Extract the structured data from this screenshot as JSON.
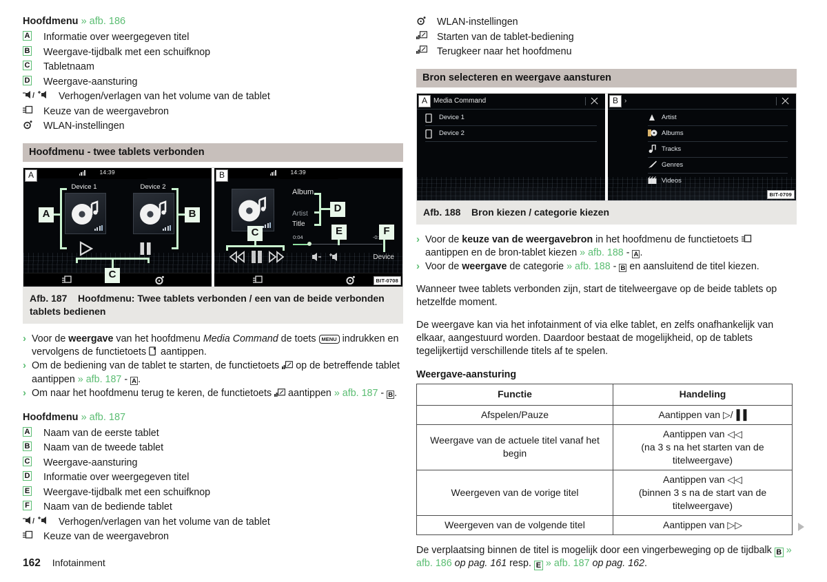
{
  "page": {
    "number": "162",
    "section": "Infotainment",
    "continuation_marker": "play-triangle"
  },
  "colors": {
    "accent_green": "#5bbd72",
    "section_header_bg": "#c7bfbb",
    "caption_bg": "#e8e7e4"
  },
  "left_column": {
    "legend1": {
      "title": "Hoofdmenu",
      "title_ref": "» afb. 186",
      "items": [
        {
          "key": "A",
          "key_type": "letter",
          "text": "Informatie over weergegeven titel"
        },
        {
          "key": "B",
          "key_type": "letter",
          "text": "Weergave-tijdbalk met een schuifknop"
        },
        {
          "key": "C",
          "key_type": "letter",
          "text": "Tabletnaam"
        },
        {
          "key": "D",
          "key_type": "letter",
          "text": "Weergave-aansturing"
        },
        {
          "key": "volume-up-down-icon",
          "key_type": "icon",
          "text": "Verhogen/verlagen van het volume van de tablet"
        },
        {
          "key": "source-select-icon",
          "key_type": "icon",
          "text": "Keuze van de weergavebron"
        },
        {
          "key": "wlan-settings-icon",
          "key_type": "icon",
          "text": "WLAN-instellingen"
        }
      ]
    },
    "section_header": "Hoofdmenu - twee tablets verbonden",
    "figure": {
      "caption_number": "Afb. 187",
      "caption_text": "Hoofdmenu: Twee tablets verbonden / een van de beide verbonden tablets bedienen",
      "code": "BIT-0708",
      "screen_a": {
        "badge": "A",
        "clock": "14:39",
        "device1": "Device 1",
        "device2": "Device 2",
        "markers": [
          "A",
          "B",
          "C"
        ]
      },
      "screen_b": {
        "badge": "B",
        "clock": "14:39",
        "album": "Album",
        "artist": "Artist",
        "title": "Title",
        "time_elapsed": "0:04",
        "time_remaining": "-0:19",
        "device": "Device",
        "markers": [
          "C",
          "D",
          "E",
          "F"
        ]
      }
    },
    "bullets": [
      {
        "parts": [
          {
            "t": "Voor de "
          },
          {
            "t": "weergave",
            "style": "bold"
          },
          {
            "t": " van het hoofdmenu "
          },
          {
            "t": "Media Command",
            "style": "italic"
          },
          {
            "t": " de toets "
          },
          {
            "t": "MENU",
            "style": "key"
          },
          {
            "t": " indrukken en vervolgens de functietoets "
          },
          {
            "t": "media-command-icon",
            "style": "icon"
          },
          {
            "t": " aantippen."
          }
        ]
      },
      {
        "parts": [
          {
            "t": "Om de bediening van de tablet te starten, de functietoets "
          },
          {
            "t": "tablet-control-icon",
            "style": "icon"
          },
          {
            "t": " op de betreffende tablet aantippen "
          },
          {
            "t": "» afb. 187",
            "style": "ref"
          },
          {
            "t": " - "
          },
          {
            "t": "A",
            "style": "ltr-sm"
          },
          {
            "t": "."
          }
        ]
      },
      {
        "parts": [
          {
            "t": "Om naar het hoofdmenu terug te keren, de functietoets "
          },
          {
            "t": "tablet-control-icon",
            "style": "icon"
          },
          {
            "t": " aantippen "
          },
          {
            "t": "» afb. 187",
            "style": "ref"
          },
          {
            "t": " - "
          },
          {
            "t": "B",
            "style": "ltr-sm"
          },
          {
            "t": "."
          }
        ]
      }
    ],
    "legend2": {
      "title": "Hoofdmenu",
      "title_ref": "» afb. 187",
      "items": [
        {
          "key": "A",
          "key_type": "letter",
          "text": "Naam van de eerste tablet"
        },
        {
          "key": "B",
          "key_type": "letter",
          "text": "Naam van de tweede tablet"
        },
        {
          "key": "C",
          "key_type": "letter",
          "text": "Weergave-aansturing"
        },
        {
          "key": "D",
          "key_type": "letter",
          "text": "Informatie over weergegeven titel"
        },
        {
          "key": "E",
          "key_type": "letter",
          "text": "Weergave-tijdbalk met een schuifknop"
        },
        {
          "key": "F",
          "key_type": "letter",
          "text": "Naam van de bediende tablet"
        },
        {
          "key": "volume-up-down-icon",
          "key_type": "icon",
          "text": "Verhogen/verlagen van het volume van de tablet"
        },
        {
          "key": "source-select-icon",
          "key_type": "icon",
          "text": "Keuze van de weergavebron"
        }
      ]
    }
  },
  "right_column": {
    "legend_continued": [
      {
        "key": "wlan-settings-icon",
        "key_type": "icon",
        "text": "WLAN-instellingen"
      },
      {
        "key": "tablet-control-icon",
        "key_type": "icon",
        "text": "Starten van de tablet-bediening"
      },
      {
        "key": "tablet-control-icon",
        "key_type": "icon",
        "text": "Terugkeer naar het hoofdmenu"
      }
    ],
    "section_header": "Bron selecteren en weergave aansturen",
    "figure": {
      "caption_number": "Afb. 188",
      "caption_text": "Bron kiezen / categorie kiezen",
      "code": "BIT-0709",
      "screen_a": {
        "badge": "A",
        "title": "Media Command",
        "rows": [
          "Device 1",
          "Device 2"
        ]
      },
      "screen_b": {
        "badge": "B",
        "title": "",
        "breadcrumb": "›",
        "rows": [
          "Artist",
          "Albums",
          "Tracks",
          "Genres",
          "Videos"
        ]
      }
    },
    "bullets": [
      {
        "parts": [
          {
            "t": "Voor de "
          },
          {
            "t": "keuze van de weergavebron",
            "style": "bold"
          },
          {
            "t": " in het hoofdmenu de functietoets "
          },
          {
            "t": "source-select-icon",
            "style": "icon"
          },
          {
            "t": " aantippen en de bron-tablet kiezen "
          },
          {
            "t": "» afb. 188",
            "style": "ref"
          },
          {
            "t": " - "
          },
          {
            "t": "A",
            "style": "ltr-sm"
          },
          {
            "t": "."
          }
        ]
      },
      {
        "parts": [
          {
            "t": "Voor de "
          },
          {
            "t": "weergave",
            "style": "bold"
          },
          {
            "t": " de categorie "
          },
          {
            "t": "» afb. 188",
            "style": "ref"
          },
          {
            "t": " - "
          },
          {
            "t": "B",
            "style": "ltr-sm"
          },
          {
            "t": " en aansluitend de titel kiezen."
          }
        ]
      }
    ],
    "paragraphs": [
      "Wanneer twee tablets verbonden zijn, start de titelweergave op de beide tablets op hetzelfde moment.",
      "De weergave kan via het infotainment of via elke tablet, en zelfs onafhankelijk van elkaar, aangestuurd worden. Daardoor bestaat de mogelijkheid, op de tablets tegelijkertijd verschillende titels af te spelen."
    ],
    "table": {
      "title": "Weergave-aansturing",
      "headers": [
        "Functie",
        "Handeling"
      ],
      "rows": [
        {
          "functie": "Afspelen/Pauze",
          "handeling": "Aantippen van ▷/▐▐"
        },
        {
          "functie": "Weergave van de actuele titel vanaf het begin",
          "handeling": "Aantippen van ◁◁\n(na 3 s na het starten van de titelweergave)"
        },
        {
          "functie": "Weergeven van de vorige titel",
          "handeling": "Aantippen van ◁◁\n(binnen 3 s na de start van de titelweergave)"
        },
        {
          "functie": "Weergeven van de volgende titel",
          "handeling": "Aantippen van ▷▷"
        }
      ]
    },
    "closing": {
      "parts": [
        {
          "t": "De verplaatsing binnen de titel is mogelijk door een vingerbeweging op de tijdbalk "
        },
        {
          "t": "B",
          "style": "ltr"
        },
        {
          "t": " "
        },
        {
          "t": "» afb. 186",
          "style": "ref"
        },
        {
          "t": " "
        },
        {
          "t": "op pag. 161",
          "style": "italic"
        },
        {
          "t": " resp. "
        },
        {
          "t": "E",
          "style": "ltr"
        },
        {
          "t": " "
        },
        {
          "t": "» afb. 187",
          "style": "ref"
        },
        {
          "t": " "
        },
        {
          "t": "op pag. 162",
          "style": "italic"
        },
        {
          "t": "."
        }
      ]
    }
  }
}
